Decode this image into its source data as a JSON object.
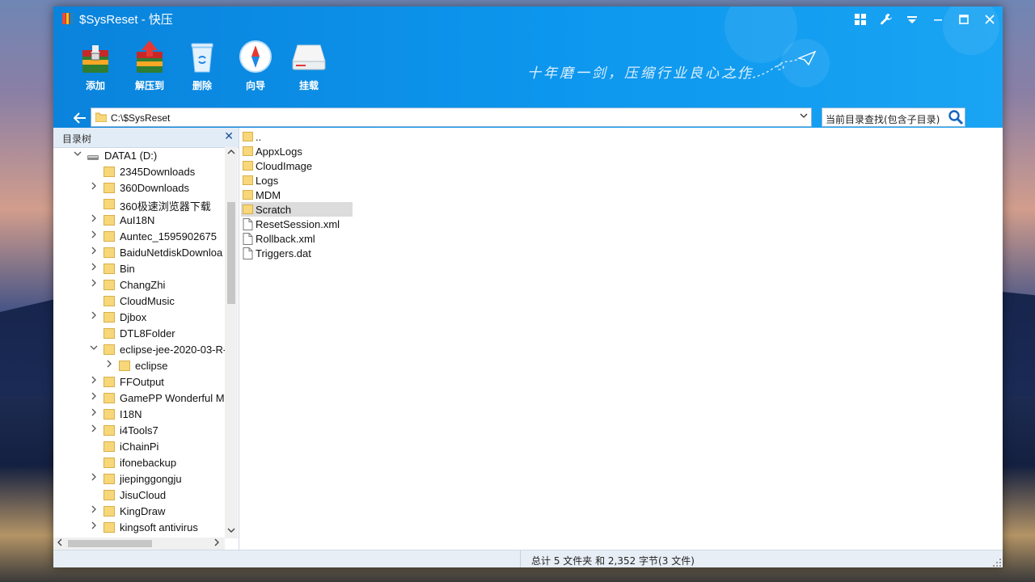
{
  "window": {
    "title": "$SysReset - 快压",
    "controls": [
      "grid-icon",
      "wrench-icon",
      "dropdown-icon",
      "minimize-icon",
      "maximize-icon",
      "close-icon"
    ]
  },
  "toolbar": {
    "add_label": "添加",
    "extract_label": "解压到",
    "delete_label": "删除",
    "wizard_label": "向导",
    "mount_label": "挂载",
    "slogan": "十年磨一剑，压缩行业良心之作"
  },
  "address": {
    "path": "C:\\$SysReset",
    "search_placeholder": "当前目录查找(包含子目录)"
  },
  "tree": {
    "header": "目录树",
    "drive": "DATA1 (D:)",
    "items": [
      {
        "label": "2345Downloads",
        "expandable": false
      },
      {
        "label": "360Downloads",
        "expandable": true
      },
      {
        "label": "360极速浏览器下载",
        "expandable": false
      },
      {
        "label": "AuI18N",
        "expandable": true
      },
      {
        "label": "Auntec_1595902675",
        "expandable": true
      },
      {
        "label": "BaiduNetdiskDownloa",
        "expandable": true
      },
      {
        "label": "Bin",
        "expandable": true
      },
      {
        "label": "ChangZhi",
        "expandable": true
      },
      {
        "label": "CloudMusic",
        "expandable": false
      },
      {
        "label": "Djbox",
        "expandable": true
      },
      {
        "label": "DTL8Folder",
        "expandable": false
      },
      {
        "label": "eclipse-jee-2020-03-R-",
        "expandable": true,
        "expanded": true
      },
      {
        "label": "eclipse",
        "expandable": true,
        "child": true
      },
      {
        "label": "FFOutput",
        "expandable": true
      },
      {
        "label": "GamePP Wonderful M",
        "expandable": true
      },
      {
        "label": "I18N",
        "expandable": true
      },
      {
        "label": "i4Tools7",
        "expandable": true
      },
      {
        "label": "iChainPi",
        "expandable": false
      },
      {
        "label": "ifonebackup",
        "expandable": false
      },
      {
        "label": "jiepinggongju",
        "expandable": true
      },
      {
        "label": "JisuCloud",
        "expandable": false
      },
      {
        "label": "KingDraw",
        "expandable": true
      },
      {
        "label": "kingsoft antivirus",
        "expandable": true
      }
    ]
  },
  "files": [
    {
      "name": "..",
      "type": "folder"
    },
    {
      "name": "AppxLogs",
      "type": "folder"
    },
    {
      "name": "CloudImage",
      "type": "folder"
    },
    {
      "name": "Logs",
      "type": "folder"
    },
    {
      "name": "MDM",
      "type": "folder"
    },
    {
      "name": "Scratch",
      "type": "folder",
      "selected": true
    },
    {
      "name": "ResetSession.xml",
      "type": "file"
    },
    {
      "name": "Rollback.xml",
      "type": "file"
    },
    {
      "name": "Triggers.dat",
      "type": "file"
    }
  ],
  "status": {
    "summary": "总计 5 文件夹  和  2,352 字节(3 文件)"
  },
  "colors": {
    "titlebar": "#0d97ee",
    "folder": "#f7d779",
    "selection": "#dcdcdc"
  }
}
